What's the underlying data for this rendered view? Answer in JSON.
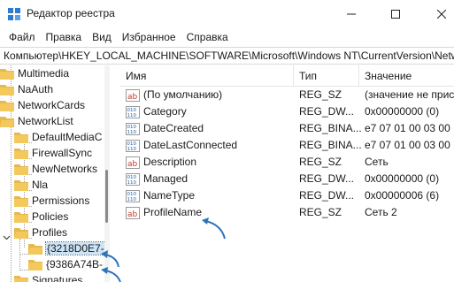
{
  "window": {
    "title": "Редактор реестра"
  },
  "menu": [
    "Файл",
    "Правка",
    "Вид",
    "Избранное",
    "Справка"
  ],
  "address": "Компьютер\\HKEY_LOCAL_MACHINE\\SOFTWARE\\Microsoft\\Windows NT\\CurrentVersion\\Netw",
  "tree": {
    "items": [
      {
        "label": "Multimedia"
      },
      {
        "label": "NaAuth"
      },
      {
        "label": "NetworkCards"
      },
      {
        "label": "NetworkList"
      },
      {
        "label": "DefaultMediaC"
      },
      {
        "label": "FirewallSync"
      },
      {
        "label": "NewNetworks"
      },
      {
        "label": "Nla"
      },
      {
        "label": "Permissions"
      },
      {
        "label": "Policies"
      },
      {
        "label": "Profiles"
      },
      {
        "label": "{3218D0E7-"
      },
      {
        "label": "{9386A74B-"
      },
      {
        "label": "Signatures"
      }
    ]
  },
  "list": {
    "columns": {
      "name": "Имя",
      "type": "Тип",
      "data": "Значение"
    },
    "rows": [
      {
        "icon": "string-value-icon",
        "name": "(По умолчанию)",
        "type": "REG_SZ",
        "data": "(значение не прис"
      },
      {
        "icon": "binary-value-icon",
        "name": "Category",
        "type": "REG_DW...",
        "data": "0x00000000 (0)"
      },
      {
        "icon": "binary-value-icon",
        "name": "DateCreated",
        "type": "REG_BINA...",
        "data": "e7 07 01 00 03 00 19"
      },
      {
        "icon": "binary-value-icon",
        "name": "DateLastConnected",
        "type": "REG_BINA...",
        "data": "e7 07 01 00 03 00 19"
      },
      {
        "icon": "string-value-icon",
        "name": "Description",
        "type": "REG_SZ",
        "data": "Сеть"
      },
      {
        "icon": "binary-value-icon",
        "name": "Managed",
        "type": "REG_DW...",
        "data": "0x00000000 (0)"
      },
      {
        "icon": "binary-value-icon",
        "name": "NameType",
        "type": "REG_DW...",
        "data": "0x00000006 (6)"
      },
      {
        "icon": "string-value-icon",
        "name": "ProfileName",
        "type": "REG_SZ",
        "data": "Сеть 2"
      }
    ]
  },
  "colors": {
    "folder": "#e8b84a",
    "arrow": "#2e75b6",
    "selection": "#cce4f7"
  }
}
